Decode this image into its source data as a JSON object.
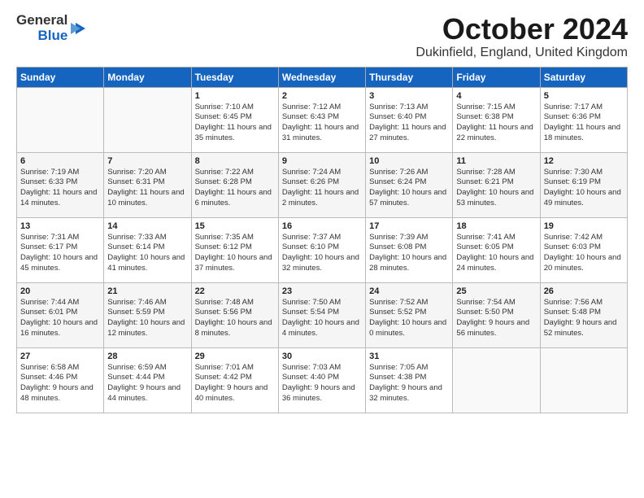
{
  "header": {
    "logo_line1": "General",
    "logo_line2": "Blue",
    "month": "October 2024",
    "location": "Dukinfield, England, United Kingdom"
  },
  "days_of_week": [
    "Sunday",
    "Monday",
    "Tuesday",
    "Wednesday",
    "Thursday",
    "Friday",
    "Saturday"
  ],
  "weeks": [
    [
      {
        "day": "",
        "info": ""
      },
      {
        "day": "",
        "info": ""
      },
      {
        "day": "1",
        "info": "Sunrise: 7:10 AM\nSunset: 6:45 PM\nDaylight: 11 hours and 35 minutes."
      },
      {
        "day": "2",
        "info": "Sunrise: 7:12 AM\nSunset: 6:43 PM\nDaylight: 11 hours and 31 minutes."
      },
      {
        "day": "3",
        "info": "Sunrise: 7:13 AM\nSunset: 6:40 PM\nDaylight: 11 hours and 27 minutes."
      },
      {
        "day": "4",
        "info": "Sunrise: 7:15 AM\nSunset: 6:38 PM\nDaylight: 11 hours and 22 minutes."
      },
      {
        "day": "5",
        "info": "Sunrise: 7:17 AM\nSunset: 6:36 PM\nDaylight: 11 hours and 18 minutes."
      }
    ],
    [
      {
        "day": "6",
        "info": "Sunrise: 7:19 AM\nSunset: 6:33 PM\nDaylight: 11 hours and 14 minutes."
      },
      {
        "day": "7",
        "info": "Sunrise: 7:20 AM\nSunset: 6:31 PM\nDaylight: 11 hours and 10 minutes."
      },
      {
        "day": "8",
        "info": "Sunrise: 7:22 AM\nSunset: 6:28 PM\nDaylight: 11 hours and 6 minutes."
      },
      {
        "day": "9",
        "info": "Sunrise: 7:24 AM\nSunset: 6:26 PM\nDaylight: 11 hours and 2 minutes."
      },
      {
        "day": "10",
        "info": "Sunrise: 7:26 AM\nSunset: 6:24 PM\nDaylight: 10 hours and 57 minutes."
      },
      {
        "day": "11",
        "info": "Sunrise: 7:28 AM\nSunset: 6:21 PM\nDaylight: 10 hours and 53 minutes."
      },
      {
        "day": "12",
        "info": "Sunrise: 7:30 AM\nSunset: 6:19 PM\nDaylight: 10 hours and 49 minutes."
      }
    ],
    [
      {
        "day": "13",
        "info": "Sunrise: 7:31 AM\nSunset: 6:17 PM\nDaylight: 10 hours and 45 minutes."
      },
      {
        "day": "14",
        "info": "Sunrise: 7:33 AM\nSunset: 6:14 PM\nDaylight: 10 hours and 41 minutes."
      },
      {
        "day": "15",
        "info": "Sunrise: 7:35 AM\nSunset: 6:12 PM\nDaylight: 10 hours and 37 minutes."
      },
      {
        "day": "16",
        "info": "Sunrise: 7:37 AM\nSunset: 6:10 PM\nDaylight: 10 hours and 32 minutes."
      },
      {
        "day": "17",
        "info": "Sunrise: 7:39 AM\nSunset: 6:08 PM\nDaylight: 10 hours and 28 minutes."
      },
      {
        "day": "18",
        "info": "Sunrise: 7:41 AM\nSunset: 6:05 PM\nDaylight: 10 hours and 24 minutes."
      },
      {
        "day": "19",
        "info": "Sunrise: 7:42 AM\nSunset: 6:03 PM\nDaylight: 10 hours and 20 minutes."
      }
    ],
    [
      {
        "day": "20",
        "info": "Sunrise: 7:44 AM\nSunset: 6:01 PM\nDaylight: 10 hours and 16 minutes."
      },
      {
        "day": "21",
        "info": "Sunrise: 7:46 AM\nSunset: 5:59 PM\nDaylight: 10 hours and 12 minutes."
      },
      {
        "day": "22",
        "info": "Sunrise: 7:48 AM\nSunset: 5:56 PM\nDaylight: 10 hours and 8 minutes."
      },
      {
        "day": "23",
        "info": "Sunrise: 7:50 AM\nSunset: 5:54 PM\nDaylight: 10 hours and 4 minutes."
      },
      {
        "day": "24",
        "info": "Sunrise: 7:52 AM\nSunset: 5:52 PM\nDaylight: 10 hours and 0 minutes."
      },
      {
        "day": "25",
        "info": "Sunrise: 7:54 AM\nSunset: 5:50 PM\nDaylight: 9 hours and 56 minutes."
      },
      {
        "day": "26",
        "info": "Sunrise: 7:56 AM\nSunset: 5:48 PM\nDaylight: 9 hours and 52 minutes."
      }
    ],
    [
      {
        "day": "27",
        "info": "Sunrise: 6:58 AM\nSunset: 4:46 PM\nDaylight: 9 hours and 48 minutes."
      },
      {
        "day": "28",
        "info": "Sunrise: 6:59 AM\nSunset: 4:44 PM\nDaylight: 9 hours and 44 minutes."
      },
      {
        "day": "29",
        "info": "Sunrise: 7:01 AM\nSunset: 4:42 PM\nDaylight: 9 hours and 40 minutes."
      },
      {
        "day": "30",
        "info": "Sunrise: 7:03 AM\nSunset: 4:40 PM\nDaylight: 9 hours and 36 minutes."
      },
      {
        "day": "31",
        "info": "Sunrise: 7:05 AM\nSunset: 4:38 PM\nDaylight: 9 hours and 32 minutes."
      },
      {
        "day": "",
        "info": ""
      },
      {
        "day": "",
        "info": ""
      }
    ]
  ]
}
